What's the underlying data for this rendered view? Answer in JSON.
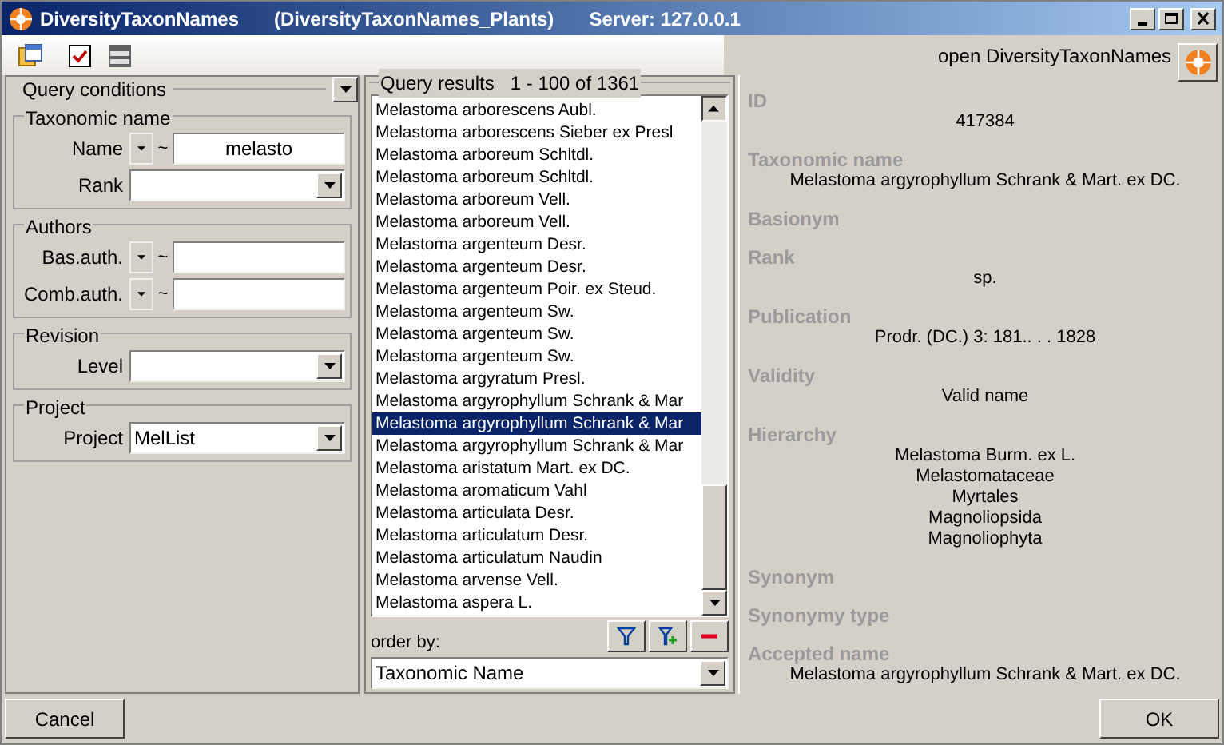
{
  "window": {
    "title": "DiversityTaxonNames",
    "database": "(DiversityTaxonNames_Plants)",
    "server": "Server: 127.0.0.1"
  },
  "toolbar": {
    "open_button": "open DiversityTaxonNames"
  },
  "query_conditions": {
    "title": "Query conditions",
    "groups": [
      {
        "title": "Taxonomic name",
        "fields": [
          {
            "kind": "match",
            "label": "Name",
            "operator": "~",
            "value": "melasto"
          },
          {
            "kind": "combo",
            "label": "Rank"
          }
        ]
      },
      {
        "title": "Authors",
        "fields": [
          {
            "kind": "match",
            "label": "Bas.auth.",
            "operator": "~"
          },
          {
            "kind": "match",
            "label": "Comb.auth.",
            "operator": "~"
          }
        ]
      },
      {
        "title": "Revision",
        "fields": [
          {
            "kind": "combo",
            "label": "Level"
          }
        ]
      },
      {
        "title": "Project",
        "fields": [
          {
            "kind": "combo",
            "label": "Project",
            "value": "MelList"
          }
        ]
      }
    ]
  },
  "query_results": {
    "title": "Query results",
    "range": "1 - 100 of 1361",
    "items": [
      {
        "text": "Melastoma arborescens Aubl.",
        "selected": false
      },
      {
        "text": "Melastoma arborescens Sieber ex Presl",
        "selected": false
      },
      {
        "text": "Melastoma arboreum Schltdl.",
        "selected": false
      },
      {
        "text": "Melastoma arboreum Schltdl.",
        "selected": false
      },
      {
        "text": "Melastoma arboreum Vell.",
        "selected": false
      },
      {
        "text": "Melastoma arboreum Vell.",
        "selected": false
      },
      {
        "text": "Melastoma argenteum Desr.",
        "selected": false
      },
      {
        "text": "Melastoma argenteum Desr.",
        "selected": false
      },
      {
        "text": "Melastoma argenteum Poir. ex Steud.",
        "selected": false
      },
      {
        "text": "Melastoma argenteum Sw.",
        "selected": false
      },
      {
        "text": "Melastoma argenteum Sw.",
        "selected": false
      },
      {
        "text": "Melastoma argenteum Sw.",
        "selected": false
      },
      {
        "text": "Melastoma argyratum Presl.",
        "selected": false
      },
      {
        "text": "Melastoma argyrophyllum Schrank & Mar",
        "selected": false
      },
      {
        "text": "Melastoma argyrophyllum Schrank & Mar",
        "selected": true
      },
      {
        "text": "Melastoma argyrophyllum Schrank & Mar",
        "selected": false
      },
      {
        "text": "Melastoma aristatum Mart. ex DC.",
        "selected": false
      },
      {
        "text": "Melastoma aromaticum Vahl",
        "selected": false
      },
      {
        "text": "Melastoma articulata Desr.",
        "selected": false
      },
      {
        "text": "Melastoma articulatum Desr.",
        "selected": false
      },
      {
        "text": "Melastoma articulatum Naudin",
        "selected": false
      },
      {
        "text": "Melastoma arvense Vell.",
        "selected": false
      },
      {
        "text": "Melastoma aspera L.",
        "selected": false
      }
    ],
    "order_by_label": "order by:",
    "order_by_value": "Taxonomic Name"
  },
  "details": [
    {
      "label": "ID",
      "values": [
        "417384"
      ]
    },
    {
      "label": "Taxonomic name",
      "values": [
        "Melastoma argyrophyllum Schrank & Mart. ex DC."
      ]
    },
    {
      "label": "Basionym"
    },
    {
      "label": "Rank",
      "values": [
        "sp."
      ]
    },
    {
      "label": "Publication",
      "values": [
        "Prodr. (DC.) 3: 181.. . . 1828"
      ]
    },
    {
      "label": "Validity",
      "values": [
        "Valid name"
      ]
    },
    {
      "label": "Hierarchy",
      "values": [
        "Melastoma Burm. ex L.",
        "Melastomataceae",
        "Myrtales",
        "Magnoliopsida",
        "Magnoliophyta"
      ]
    },
    {
      "label": "Synonym"
    },
    {
      "label": "Synonymy type"
    },
    {
      "label": "Accepted name",
      "values": [
        "Melastoma argyrophyllum Schrank & Mart. ex DC."
      ]
    }
  ],
  "buttons": {
    "cancel": "Cancel",
    "ok": "OK"
  }
}
